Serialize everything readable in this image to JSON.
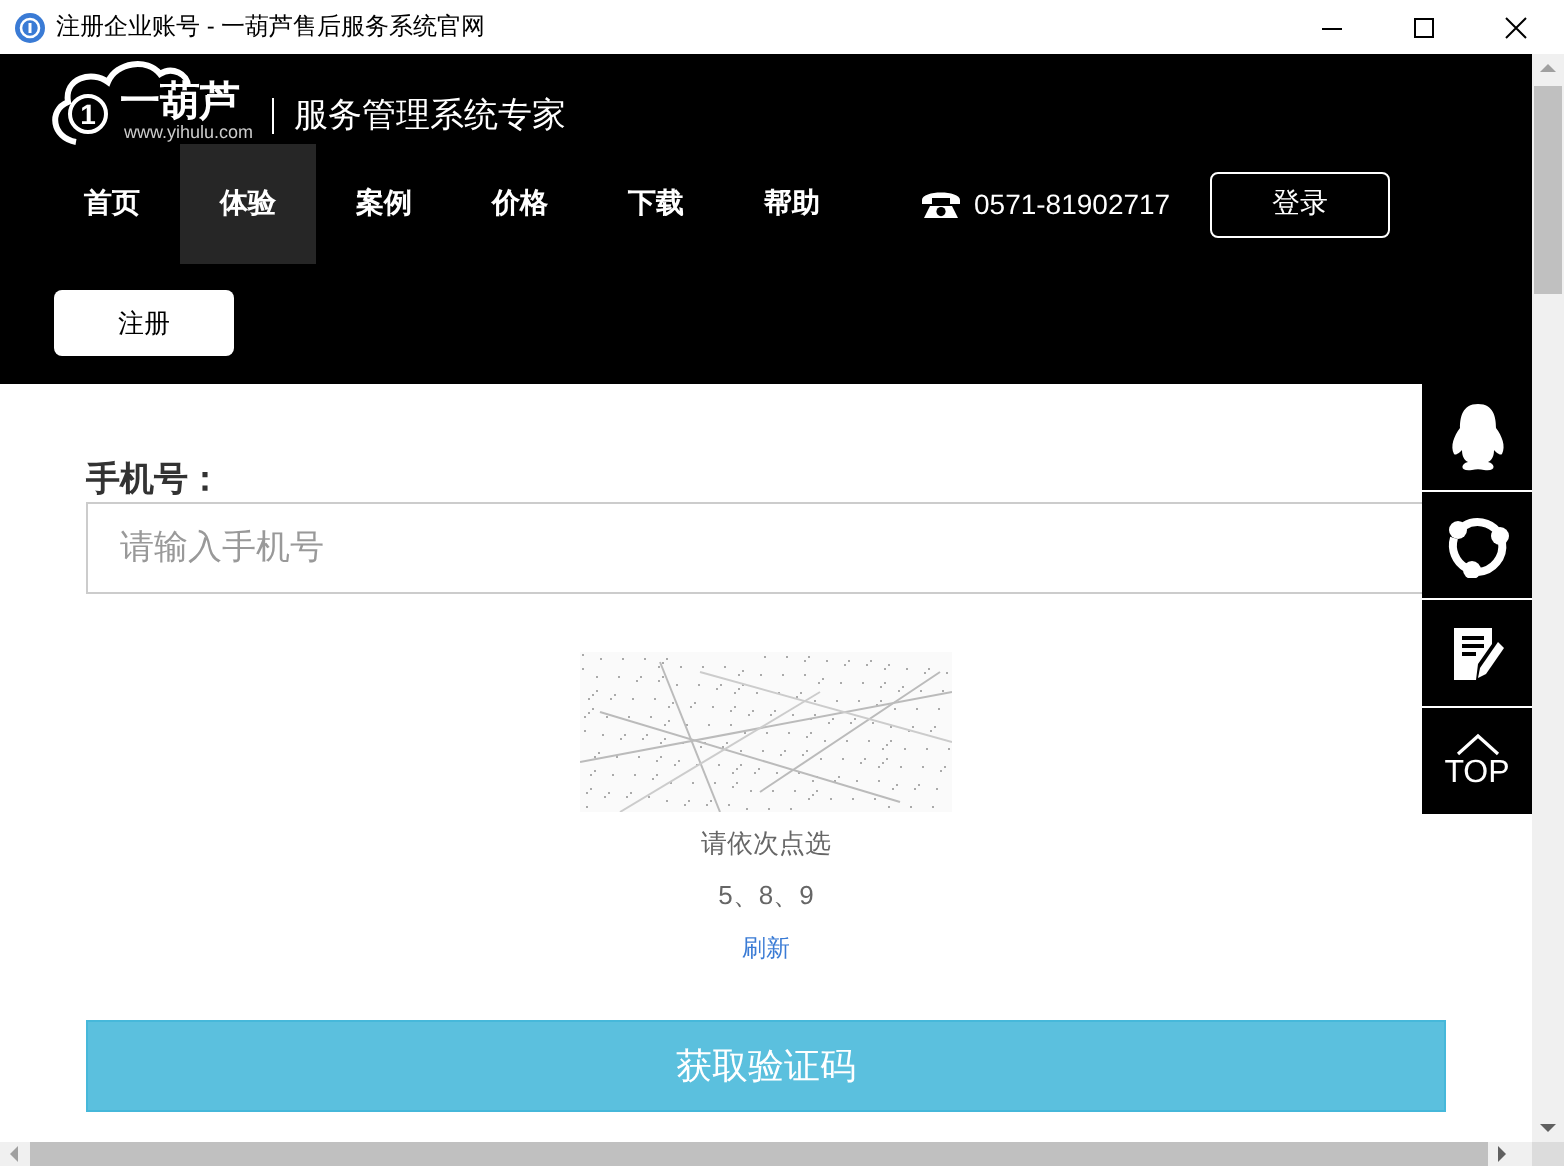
{
  "window": {
    "title": "注册企业账号 - 一葫芦售后服务系统官网"
  },
  "header": {
    "logo": {
      "mark": "1",
      "name": "一葫芦",
      "url": "www.yihulu.com"
    },
    "tagline": "服务管理系统专家",
    "nav": [
      {
        "label": "首页",
        "selected": false
      },
      {
        "label": "体验",
        "selected": true
      },
      {
        "label": "案例",
        "selected": false
      },
      {
        "label": "价格",
        "selected": false
      },
      {
        "label": "下载",
        "selected": false
      },
      {
        "label": "帮助",
        "selected": false
      }
    ],
    "phone": "0571-81902717",
    "login_button": "登录",
    "register_button": "注册"
  },
  "form": {
    "phone_label": "手机号：",
    "phone_placeholder": "请输入手机号",
    "captcha_hint": "请依次点选",
    "captcha_answer": "5、8、9",
    "refresh_link": "刷新",
    "submit_button": "获取验证码"
  },
  "side_tools": [
    {
      "kind": "qq"
    },
    {
      "kind": "share"
    },
    {
      "kind": "note"
    },
    {
      "kind": "top",
      "label": "TOP"
    }
  ]
}
